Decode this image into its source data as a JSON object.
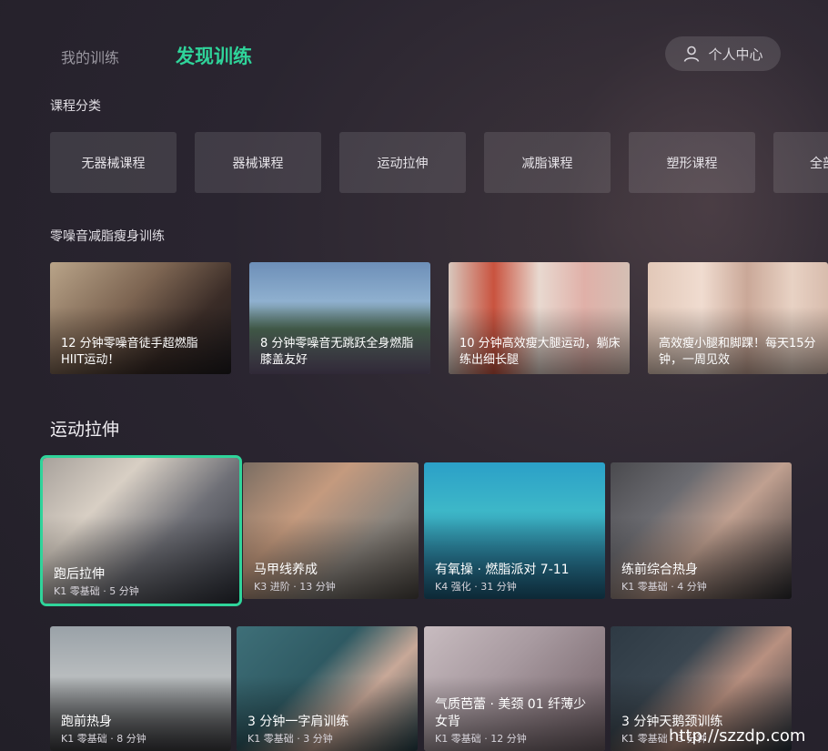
{
  "nav": {
    "tab_mine": "我的训练",
    "tab_discover": "发现训练",
    "user_center": "个人中心"
  },
  "sections": {
    "categories_title": "课程分类",
    "quiet_title": "零噪音减脂瘦身训练",
    "stretch_title": "运动拉伸"
  },
  "categories": [
    "无器械课程",
    "器械课程",
    "运动拉伸",
    "减脂课程",
    "塑形课程",
    "全部"
  ],
  "quiet_cards": [
    {
      "title": "12 分钟零噪音徒手超燃脂 HIIT运动！"
    },
    {
      "title": "8 分钟零噪音无跳跃全身燃脂 膝盖友好"
    },
    {
      "title": "10 分钟高效瘦大腿运动，躺床练出细长腿"
    },
    {
      "title": "高效瘦小腿和脚踝！每天15分钟，一周见效"
    }
  ],
  "stretch_cards": [
    {
      "title": "跑后拉伸",
      "meta": "K1 零基础 · 5 分钟"
    },
    {
      "title": "马甲线养成",
      "meta": "K3 进阶 · 13 分钟"
    },
    {
      "title": "有氧操 · 燃脂派对 7-11",
      "meta": "K4 强化 · 31 分钟"
    },
    {
      "title": "练前综合热身",
      "meta": "K1 零基础 · 4 分钟"
    },
    {
      "title": "跑前热身",
      "meta": "K1 零基础 · 8 分钟"
    },
    {
      "title": "3 分钟一字肩训练",
      "meta": "K1 零基础 · 3 分钟"
    },
    {
      "title": "气质芭蕾 · 美颈 01 纤薄少女背",
      "meta": "K1 零基础 · 12 分钟"
    },
    {
      "title": "3 分钟天鹅颈训练",
      "meta": "K1 零基础 · 3 分钟"
    }
  ],
  "watermark": "http://szzdp.com",
  "colors": {
    "accent": "#2fd49a",
    "background": "#2a2530"
  },
  "icons": {
    "user_center": "person-icon"
  }
}
